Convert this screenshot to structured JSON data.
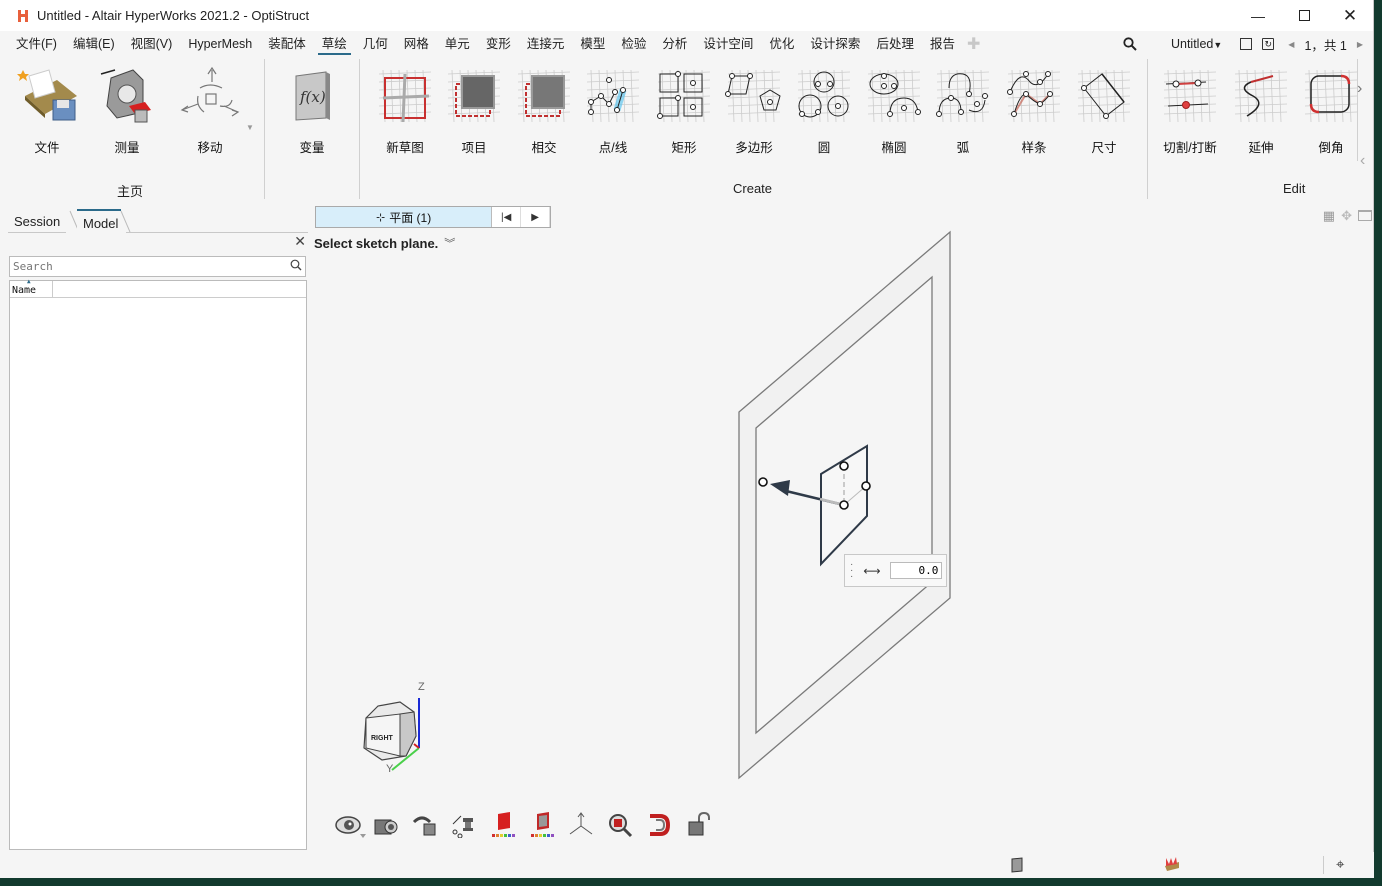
{
  "window": {
    "title": "Untitled - Altair HyperWorks 2021.2 - OptiStruct",
    "minimize_icon": "minimize-icon",
    "maximize_icon": "maximize-icon",
    "close_icon": "close-icon"
  },
  "menubar": {
    "items": [
      {
        "label": "文件(F)"
      },
      {
        "label": "编辑(E)"
      },
      {
        "label": "视图(V)"
      },
      {
        "label": "HyperMesh"
      },
      {
        "label": "装配体"
      },
      {
        "label": "草绘",
        "active": true
      },
      {
        "label": "几何"
      },
      {
        "label": "网格"
      },
      {
        "label": "单元"
      },
      {
        "label": "变形"
      },
      {
        "label": "连接元"
      },
      {
        "label": "模型"
      },
      {
        "label": "检验"
      },
      {
        "label": "分析"
      },
      {
        "label": "设计空间"
      },
      {
        "label": "优化"
      },
      {
        "label": "设计探索"
      },
      {
        "label": "后处理"
      },
      {
        "label": "报告"
      }
    ],
    "add_tab_icon": "plus-icon",
    "search_icon": "search-icon",
    "session_name": "Untitled",
    "page_indicator": "1，共 1"
  },
  "ribbon": {
    "groups": [
      {
        "label": "主页",
        "buttons": [
          {
            "label": "文件",
            "icon": "file-folder-icon"
          },
          {
            "label": "测量",
            "icon": "measure-icon"
          },
          {
            "label": "移动",
            "icon": "move-icon"
          }
        ]
      },
      {
        "label": "",
        "buttons": [
          {
            "label": "变量",
            "icon": "function-variable-icon"
          }
        ]
      },
      {
        "label": "Create",
        "buttons": [
          {
            "label": "新草图",
            "icon": "new-sketch-icon"
          },
          {
            "label": "项目",
            "icon": "project-icon"
          },
          {
            "label": "相交",
            "icon": "intersect-icon"
          },
          {
            "label": "点/线",
            "icon": "point-line-icon"
          },
          {
            "label": "矩形",
            "icon": "rectangle-icon"
          },
          {
            "label": "多边形",
            "icon": "polygon-icon"
          },
          {
            "label": "圆",
            "icon": "circle-icon"
          },
          {
            "label": "椭圆",
            "icon": "ellipse-icon"
          },
          {
            "label": "弧",
            "icon": "arc-icon"
          },
          {
            "label": "样条",
            "icon": "spline-icon"
          },
          {
            "label": "尺寸",
            "icon": "dimension-icon"
          }
        ]
      },
      {
        "label": "Edit",
        "buttons": [
          {
            "label": "切割/打断",
            "icon": "trim-break-icon"
          },
          {
            "label": "延伸",
            "icon": "extend-icon"
          },
          {
            "label": "倒角",
            "icon": "fillet-icon"
          }
        ]
      }
    ]
  },
  "leftpanel": {
    "tabs": [
      {
        "label": "Session"
      },
      {
        "label": "Model",
        "active": true
      }
    ],
    "search_placeholder": "Search",
    "column_header": "Name"
  },
  "viewport": {
    "guide_selector": "平面 (1)",
    "prompt": "Select sketch plane.",
    "dimension_value": "0.0",
    "triad": {
      "z_label": "Z",
      "y_label": "Y",
      "cube_face": "RIGHT"
    },
    "bottom_tools": [
      {
        "name": "visualization-eye-icon"
      },
      {
        "name": "camera-icon"
      },
      {
        "name": "view-rotate-icon"
      },
      {
        "name": "section-icon"
      },
      {
        "name": "color-by-part-icon"
      },
      {
        "name": "color-by-element-icon"
      },
      {
        "name": "axis-triad-icon"
      },
      {
        "name": "zoom-fit-icon"
      },
      {
        "name": "3d-display-icon"
      },
      {
        "name": "unlock-icon"
      }
    ]
  },
  "statusbar": {
    "icons": [
      "part-icon",
      "model-icon",
      "crosshair-icon"
    ]
  }
}
